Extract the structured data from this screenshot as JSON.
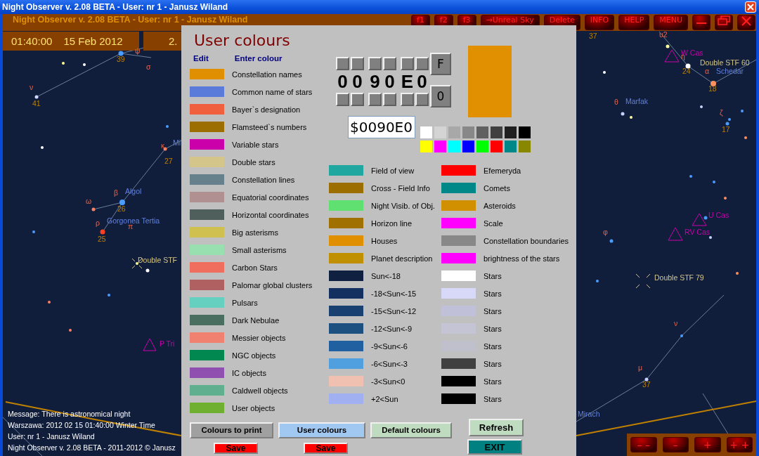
{
  "window": {
    "title": "Night Observer v. 2.08 BETA -  User:  nr 1 - Janusz Wiland"
  },
  "app_bar": {
    "title": "Night Observer v. 2.08 BETA -  User:  nr 1 - Janusz Wiland",
    "buttons": [
      {
        "kind": "text",
        "label": "f1"
      },
      {
        "kind": "text",
        "label": "f2"
      },
      {
        "kind": "text",
        "label": "f3"
      },
      {
        "kind": "text",
        "label": "→Unreal Sky"
      },
      {
        "kind": "text",
        "label": "Delete"
      },
      {
        "kind": "text",
        "label": "INFO"
      },
      {
        "kind": "text",
        "label": "HELP"
      },
      {
        "kind": "text",
        "label": "MENU"
      },
      {
        "kind": "minimize"
      },
      {
        "kind": "restore"
      },
      {
        "kind": "close"
      }
    ]
  },
  "clock": {
    "time": "01:40:00",
    "date": "15 Feb 2012",
    "panel_2": "2."
  },
  "sky_labels": [
    {
      "text": "39",
      "kind": "number"
    },
    {
      "text": "ψ",
      "kind": "greek"
    },
    {
      "text": "σ",
      "kind": "greek"
    },
    {
      "text": "ν",
      "kind": "greek"
    },
    {
      "text": "41",
      "kind": "number"
    },
    {
      "text": "Mi",
      "kind": "name"
    },
    {
      "text": "κ",
      "kind": "greek"
    },
    {
      "text": "27",
      "kind": "number"
    },
    {
      "text": "β",
      "kind": "greek"
    },
    {
      "text": "Algol",
      "kind": "name"
    },
    {
      "text": "26",
      "kind": "number"
    },
    {
      "text": "ω",
      "kind": "greek"
    },
    {
      "text": "π",
      "kind": "greek"
    },
    {
      "text": "ρ",
      "kind": "greek"
    },
    {
      "text": "Gorgonea Tertia",
      "kind": "name"
    },
    {
      "text": "25",
      "kind": "number"
    },
    {
      "text": "Double STF",
      "kind": "double"
    },
    {
      "text": "P Tri",
      "kind": "variable"
    },
    {
      "text": "37",
      "kind": "number"
    },
    {
      "text": "υ2",
      "kind": "greek"
    },
    {
      "text": "W Cas",
      "kind": "variable"
    },
    {
      "text": "η",
      "kind": "greek"
    },
    {
      "text": "Double STF  60",
      "kind": "double"
    },
    {
      "text": "24",
      "kind": "number"
    },
    {
      "text": "α",
      "kind": "greek"
    },
    {
      "text": "Schedar",
      "kind": "name"
    },
    {
      "text": "18",
      "kind": "number"
    },
    {
      "text": "θ",
      "kind": "greek"
    },
    {
      "text": "Marfak",
      "kind": "name"
    },
    {
      "text": "ζ",
      "kind": "greek"
    },
    {
      "text": "17",
      "kind": "number"
    },
    {
      "text": "U Cas",
      "kind": "variable"
    },
    {
      "text": "RV Cas",
      "kind": "variable"
    },
    {
      "text": "φ",
      "kind": "greek"
    },
    {
      "text": "Double STF  79",
      "kind": "double"
    },
    {
      "text": "ν",
      "kind": "greek"
    },
    {
      "text": "μ",
      "kind": "greek"
    },
    {
      "text": "37",
      "kind": "number"
    },
    {
      "text": "Mirach",
      "kind": "name"
    }
  ],
  "status_lines": [
    "Message: There is astronomical night",
    "Warszawa:  2012 02 15  01:40:00 Winter Time",
    "User:  nr 1 - Janusz Wiland",
    "Night Observer v. 2.08 BETA - 2011-2012 © Janusz"
  ],
  "zoom_buttons": [
    "– –",
    "–",
    "+",
    "+ +"
  ],
  "dialog": {
    "title": "User colours",
    "headers": [
      "Edit",
      "Enter colour"
    ],
    "hex_digits": [
      "0",
      "0",
      "9",
      "0",
      "E",
      "0"
    ],
    "digit_buttons": [
      "F",
      "0"
    ],
    "hex_value": "$0090E0",
    "palette": [
      {
        "color": "#ffffff"
      },
      {
        "color": "#d4d4d4"
      },
      {
        "color": "#a8a8a8"
      },
      {
        "color": "#888888"
      },
      {
        "color": "#606060"
      },
      {
        "color": "#404040"
      },
      {
        "color": "#202020"
      },
      {
        "color": "#000000"
      },
      {
        "color": "#ffff00"
      },
      {
        "color": "#ff00ff"
      },
      {
        "color": "#00ffff"
      },
      {
        "color": "#0000ff"
      },
      {
        "color": "#00ff00"
      },
      {
        "color": "#ff0000"
      },
      {
        "color": "#008888"
      },
      {
        "color": "#888800"
      }
    ],
    "columns": [
      [
        {
          "label": "Constellation names",
          "color": "#e08f00"
        },
        {
          "label": "Common name of stars",
          "color": "#5b7bdb"
        },
        {
          "label": "Bayer`s designation",
          "color": "#f0603f"
        },
        {
          "label": "Flamsteed`s numbers",
          "color": "#9c6e00"
        },
        {
          "label": "Variable stars",
          "color": "#cc00aa"
        },
        {
          "label": "Double stars",
          "color": "#d4c68a"
        },
        {
          "label": "Constellation lines",
          "color": "#66808c"
        },
        {
          "label": "Equatorial coordinates",
          "color": "#b09090"
        },
        {
          "label": "Horizontal coordinates",
          "color": "#4f5f5b"
        },
        {
          "label": "Big asterisms",
          "color": "#d0c050"
        },
        {
          "label": "Small asterisms",
          "color": "#99e0b0"
        },
        {
          "label": "Carbon Stars",
          "color": "#f06e5e"
        },
        {
          "label": "Palomar global clusters",
          "color": "#b06060"
        },
        {
          "label": "Pulsars",
          "color": "#66d0c0"
        },
        {
          "label": "Dark Nebulae",
          "color": "#4a6e60"
        },
        {
          "label": "Messier objects",
          "color": "#f08070"
        },
        {
          "label": "NGC objects",
          "color": "#008850"
        },
        {
          "label": "IC objects",
          "color": "#9050b0"
        },
        {
          "label": "Caldwell objects",
          "color": "#60b090"
        },
        {
          "label": "User objects",
          "color": "#70b030"
        }
      ],
      [
        {
          "label": "Field of view",
          "color": "#20a8a0"
        },
        {
          "label": "Cross - Field Info",
          "color": "#9c6e00"
        },
        {
          "label": "Night Visib. of Obj.",
          "color": "#60e070"
        },
        {
          "label": "Horizon line",
          "color": "#a07000"
        },
        {
          "label": "Houses",
          "color": "#e08f00"
        },
        {
          "label": "Planet description",
          "color": "#c09000"
        },
        {
          "label": "Sun<-18",
          "color": "#102040"
        },
        {
          "label": "-18<Sun<-15",
          "color": "#143060"
        },
        {
          "label": "-15<Sun<-12",
          "color": "#184070"
        },
        {
          "label": "-12<Sun<-9",
          "color": "#1c5080"
        },
        {
          "label": "-9<Sun<-6",
          "color": "#2060a0"
        },
        {
          "label": "-6<Sun<-3",
          "color": "#50a0e0"
        },
        {
          "label": "-3<Sun<0",
          "color": "#f0c0b0"
        },
        {
          "label": "+2<Sun",
          "color": "#a0b0f0"
        }
      ],
      [
        {
          "label": "Efemeryda",
          "color": "#ff0000"
        },
        {
          "label": "Comets",
          "color": "#008888"
        },
        {
          "label": "Asteroids",
          "color": "#d09000"
        },
        {
          "label": "Scale",
          "color": "#ff00ff"
        },
        {
          "label": "Constellation boundaries",
          "color": "#888888"
        },
        {
          "label": "brightness of the stars",
          "color": "#ff00ff"
        },
        {
          "label": "Stars",
          "color": "#ffffff"
        },
        {
          "label": "Stars",
          "color": "#d8d8f8"
        },
        {
          "label": "Stars",
          "color": "#c0c0d8"
        },
        {
          "label": "Stars",
          "color": "#c4c4d4"
        },
        {
          "label": "Stars",
          "color": "#c0c0cc"
        },
        {
          "label": "Stars",
          "color": "#404040"
        },
        {
          "label": "Stars",
          "color": "#000000"
        },
        {
          "label": "Stars",
          "color": "#000000"
        }
      ]
    ],
    "buttons": [
      {
        "label": "Colours to print",
        "kind": "print"
      },
      {
        "label": "User colours",
        "kind": "user"
      },
      {
        "label": "Default colours",
        "kind": "default"
      }
    ],
    "refresh": "Refresh",
    "save_buttons": [
      "Save",
      "Save"
    ],
    "exit": "EXIT"
  }
}
